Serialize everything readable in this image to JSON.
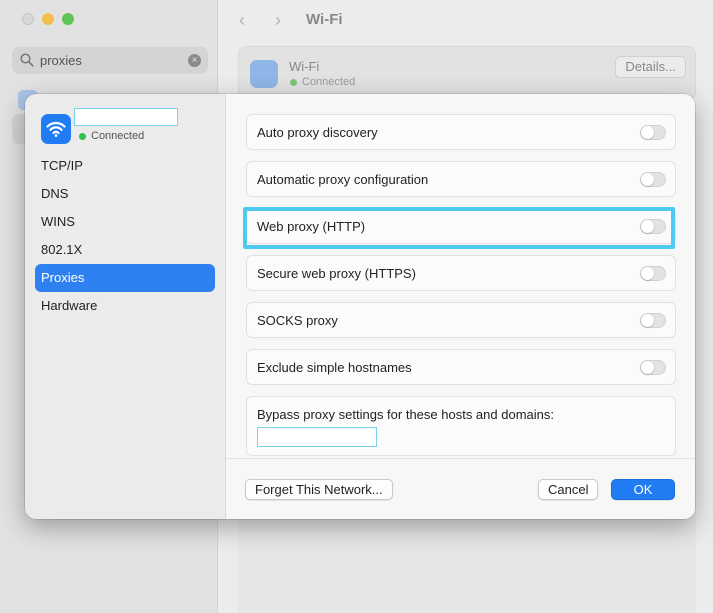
{
  "background": {
    "search": {
      "value": "proxies"
    },
    "header": {
      "back": "‹",
      "forward": "›",
      "title": "Wi-Fi"
    },
    "wifi_card": {
      "name": "Wi-Fi",
      "status": "Connected",
      "details_label": "Details..."
    }
  },
  "sheet": {
    "network": {
      "status": "Connected"
    },
    "tabs": [
      {
        "label": "TCP/IP"
      },
      {
        "label": "DNS"
      },
      {
        "label": "WINS"
      },
      {
        "label": "802.1X"
      },
      {
        "label": "Proxies"
      },
      {
        "label": "Hardware"
      }
    ],
    "selected_tab": "Proxies",
    "rows": [
      {
        "label": "Auto proxy discovery",
        "enabled": false
      },
      {
        "label": "Automatic proxy configuration",
        "enabled": false
      },
      {
        "label": "Web proxy (HTTP)",
        "enabled": false
      },
      {
        "label": "Secure web proxy (HTTPS)",
        "enabled": false
      },
      {
        "label": "SOCKS proxy",
        "enabled": false
      },
      {
        "label": "Exclude simple hostnames",
        "enabled": false
      }
    ],
    "bypass": {
      "label": "Bypass proxy settings for these hosts and domains:",
      "value": ""
    },
    "footer": {
      "forget_label": "Forget This Network...",
      "cancel_label": "Cancel",
      "ok_label": "OK"
    }
  },
  "colors": {
    "accent": "#1f7cf2",
    "selected_tab": "#2f80f0",
    "highlight": "#4fcbef",
    "connected": "#2fbf4a"
  }
}
